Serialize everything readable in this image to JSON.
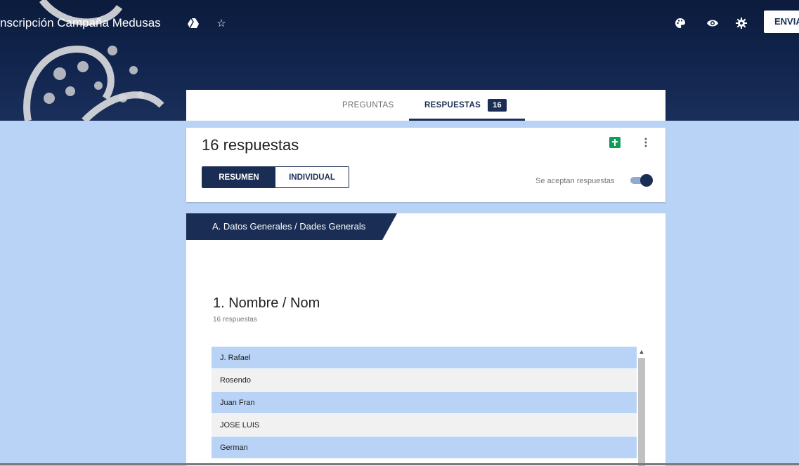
{
  "header": {
    "title": "nscripción Campaña Medusas",
    "send_label": "ENVIA",
    "icons": [
      "drive-folder-icon",
      "star-icon",
      "palette-icon",
      "preview-eye-icon",
      "settings-gear-icon"
    ]
  },
  "tabs": {
    "questions_label": "PREGUNTAS",
    "responses_label": "RESPUESTAS",
    "responses_count": "16"
  },
  "summary": {
    "title": "16 respuestas",
    "segments": {
      "summary": "RESUMEN",
      "individual": "INDIVIDUAL"
    },
    "accepting_label": "Se aceptan respuestas",
    "accepting_on": true
  },
  "section": {
    "title": "A. Datos Generales / Dades Generals",
    "question": {
      "title": "1. Nombre / Nom",
      "count_label": "16 respuestas",
      "answers": [
        "J. Rafael",
        "Rosendo",
        "Juan Fran",
        "JOSE LUIS",
        "German"
      ]
    }
  },
  "colors": {
    "brand_dark": "#1a2e55",
    "page_background": "#b9d3f6",
    "sheets_green": "#0f9d58",
    "row_alt": "#f1f1f1"
  }
}
